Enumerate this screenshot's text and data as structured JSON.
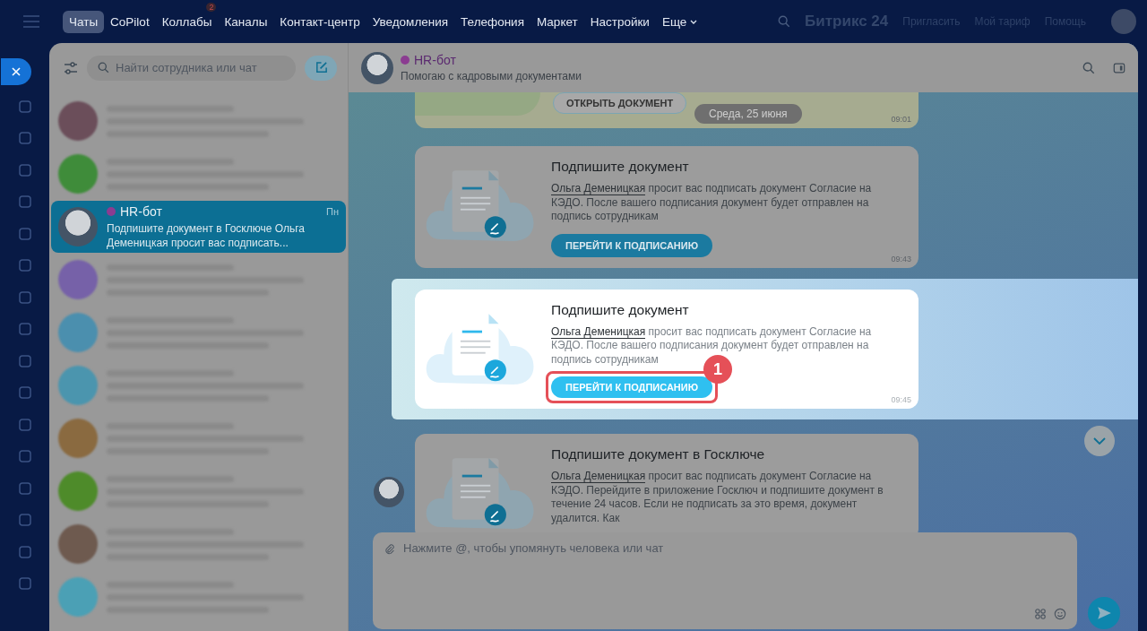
{
  "top_nav": {
    "items": [
      {
        "label": "Чаты",
        "selected": true,
        "kind": "link"
      },
      {
        "label": "CoPilot",
        "selected": false,
        "kind": "link"
      },
      {
        "label": "Коллабы",
        "selected": false,
        "kind": "link",
        "badge": "2"
      },
      {
        "label": "Каналы",
        "selected": false,
        "kind": "link"
      },
      {
        "label": "Контакт-центр",
        "selected": false,
        "kind": "link"
      },
      {
        "label": "Уведомления",
        "selected": false,
        "kind": "link"
      },
      {
        "label": "Телефония",
        "selected": false,
        "kind": "link"
      },
      {
        "label": "Маркет",
        "selected": false,
        "kind": "link"
      },
      {
        "label": "Настройки",
        "selected": false,
        "kind": "link"
      },
      {
        "label": "Еще",
        "selected": false,
        "kind": "menu"
      }
    ],
    "logo": "Битрикс 24",
    "links": [
      "Пригласить",
      "Мой тариф",
      "Помощь"
    ]
  },
  "sidebar": {
    "search": {
      "placeholder": "Найти сотрудника или чат"
    },
    "chats": [
      {
        "kind": "blurred",
        "color": "#6b4e5a",
        "selected": false
      },
      {
        "kind": "blurred",
        "color": "#3f8c3a",
        "selected": false
      },
      {
        "kind": "chat",
        "name": "HR-бот",
        "time": "Пн",
        "preview": "Подпишите документ в Госключе Ольга Деменицкая просит вас подписать...",
        "selected": true
      },
      {
        "kind": "blurred",
        "color": "#7661a8",
        "selected": false
      },
      {
        "kind": "blurred",
        "color": "#4b8fae",
        "selected": false
      },
      {
        "kind": "blurred",
        "color": "#4b95ae",
        "selected": false
      },
      {
        "kind": "blurred",
        "color": "#8a6a40",
        "selected": false
      },
      {
        "kind": "blurred",
        "color": "#4e8b2a",
        "selected": false
      },
      {
        "kind": "blurred",
        "color": "#6e5a4f",
        "selected": false
      },
      {
        "kind": "blurred",
        "color": "#4ba0b5",
        "selected": false
      }
    ]
  },
  "chat": {
    "name": "HR-бот",
    "subtitle": "Помогаю с кадровыми документами",
    "date_pill": "Среда, 25 июня",
    "messages": [
      {
        "kind": "partial",
        "button": "ОТКРЫТЬ ДОКУМЕНТ",
        "time": "09:01",
        "highlighted": false
      },
      {
        "kind": "sign",
        "title": "Подпишите документ",
        "link": "Ольга Деменицкая",
        "text": "просит вас подписать документ Согласие на КЭДО. После вашего подписания документ будет отправлен на подпись сотрудникам",
        "button": "ПЕРЕЙТИ К ПОДПИСАНИЮ",
        "time": "09:43",
        "highlighted": false
      },
      {
        "kind": "sign",
        "title": "Подпишите документ",
        "link": "Ольга Деменицкая",
        "text": "просит вас подписать документ Согласие на КЭДО. После вашего подписания документ будет отправлен на подпись сотрудникам",
        "button": "ПЕРЕЙТИ К ПОДПИСАНИЮ",
        "time": "09:45",
        "highlighted": true,
        "callout": "1"
      },
      {
        "kind": "sign",
        "title": "Подпишите документ в Госключе",
        "link": "Ольга Деменицкая",
        "text": "просит вас подписать документ Согласие на КЭДО. Перейдите в приложение Госключ и подпишите документ в течение 24 часов. Если не подписать за это время, документ удалится. Как",
        "highlighted": false
      }
    ],
    "composer": {
      "placeholder": "Нажмите @, чтобы упомянуть человека или чат"
    }
  }
}
